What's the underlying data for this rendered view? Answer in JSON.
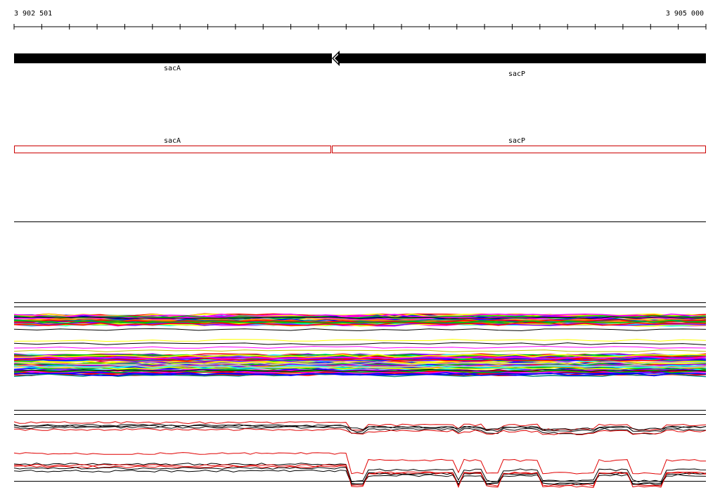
{
  "coordinates": {
    "start": "3 902 501",
    "end": "3 905 000"
  },
  "genes": [
    {
      "name": "sacA",
      "strand": "reverse"
    },
    {
      "name": "sacP",
      "strand": "reverse"
    }
  ],
  "annotation_boxes": [
    {
      "name": "sacA"
    },
    {
      "name": "sacP"
    }
  ],
  "colors": {
    "gene": "#000000",
    "annotation_box": "#cc0000",
    "profile_red": "#e00000",
    "profile_black": "#000000",
    "rainbow": [
      "#ff00ff",
      "#00ffff",
      "#00c000",
      "#ffff00",
      "#0000ff",
      "#ff8000",
      "#8000ff",
      "#ff0000",
      "#008080",
      "#c0c0c0"
    ]
  }
}
